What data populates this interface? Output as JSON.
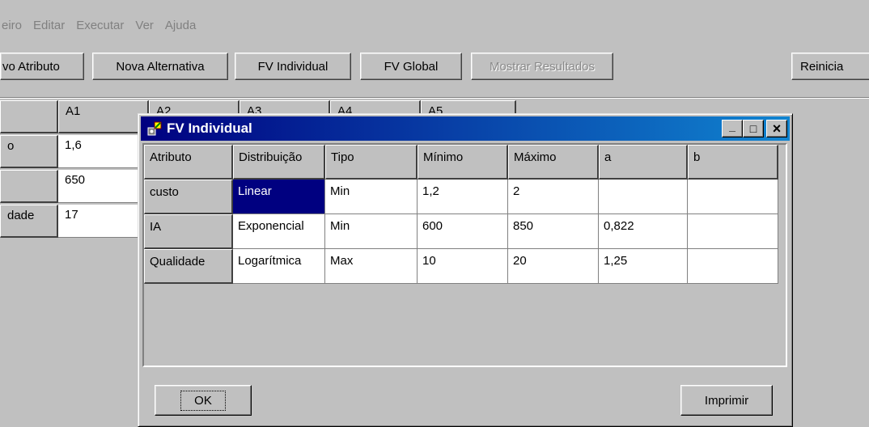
{
  "menu": [
    "eiro",
    "Editar",
    "Executar",
    "Ver",
    "Ajuda"
  ],
  "toolbar": {
    "buttons": [
      {
        "label": "vo Atributo",
        "disabled": false
      },
      {
        "label": "Nova Alternativa",
        "disabled": false
      },
      {
        "label": "FV Individual",
        "disabled": false
      },
      {
        "label": "FV Global",
        "disabled": false
      },
      {
        "label": "Mostrar Resultados",
        "disabled": true
      },
      {
        "label": "Reinicia",
        "disabled": false
      }
    ]
  },
  "background_grid": {
    "headers": [
      "",
      "A1",
      "A2",
      "A3",
      "A4",
      "A5"
    ],
    "rows": [
      {
        "label": "o",
        "a1": "1,6"
      },
      {
        "label": "",
        "a1": "650"
      },
      {
        "label": "dade",
        "a1": "17"
      }
    ]
  },
  "dialog": {
    "title": "FV Individual",
    "columns": [
      "Atributo",
      "Distribuição",
      "Tipo",
      "Mínimo",
      "Máximo",
      "a",
      "b"
    ],
    "rows": [
      [
        "custo",
        "Linear",
        "Min",
        "1,2",
        "2",
        "",
        ""
      ],
      [
        "IA",
        "Exponencial",
        "Min",
        "600",
        "850",
        "0,822",
        ""
      ],
      [
        "Qualidade",
        "Logarítmica",
        "Max",
        "10",
        "20",
        "1,25",
        ""
      ]
    ],
    "selected_cell": {
      "row": 0,
      "col": 1
    },
    "ok_label": "OK",
    "print_label": "Imprimir",
    "window_buttons": {
      "minimize": "_",
      "maximize": "□",
      "close": "×"
    }
  },
  "colors": {
    "face": "#c0c0c0",
    "title": "#000080",
    "selection": "#000080"
  }
}
